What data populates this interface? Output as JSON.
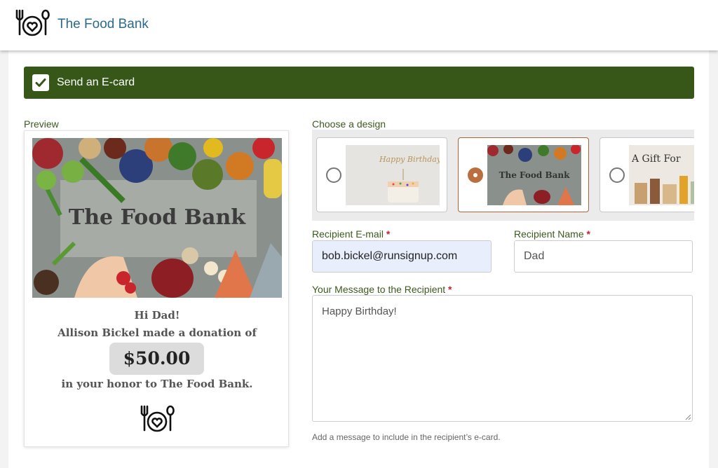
{
  "header": {
    "brand": "The Food Bank",
    "logo_icon": "plate-fork-spoon-heart-icon"
  },
  "ecard": {
    "checked": true,
    "label": "Send an E-card",
    "accent_color": "#375719"
  },
  "preview": {
    "section_label": "Preview",
    "image_title": "The Food Bank",
    "greeting": "Hi Dad!",
    "donor_line": "Allison Bickel made a donation of",
    "amount": "$50.00",
    "honor_line": "in your honor to The Food Bank."
  },
  "designs": {
    "section_label": "Choose a design",
    "options": [
      {
        "name": "Happy Birthday",
        "thumb_text": "Happy Birthday",
        "selected": false
      },
      {
        "name": "The Food Bank",
        "thumb_text": "The Food Bank",
        "selected": true
      },
      {
        "name": "A Gift For",
        "thumb_text": "A Gift For",
        "selected": false
      }
    ],
    "selected_color": "#bc6f3e"
  },
  "form": {
    "email_label": "Recipient E-mail",
    "email_value": "bob.bickel@runsignup.com",
    "name_label": "Recipient Name",
    "name_value": "Dad",
    "message_label": "Your Message to the Recipient",
    "message_value": "Happy Birthday!",
    "required_marker": "*",
    "help_text": "Add a message to include in the recipient’s e-card."
  }
}
